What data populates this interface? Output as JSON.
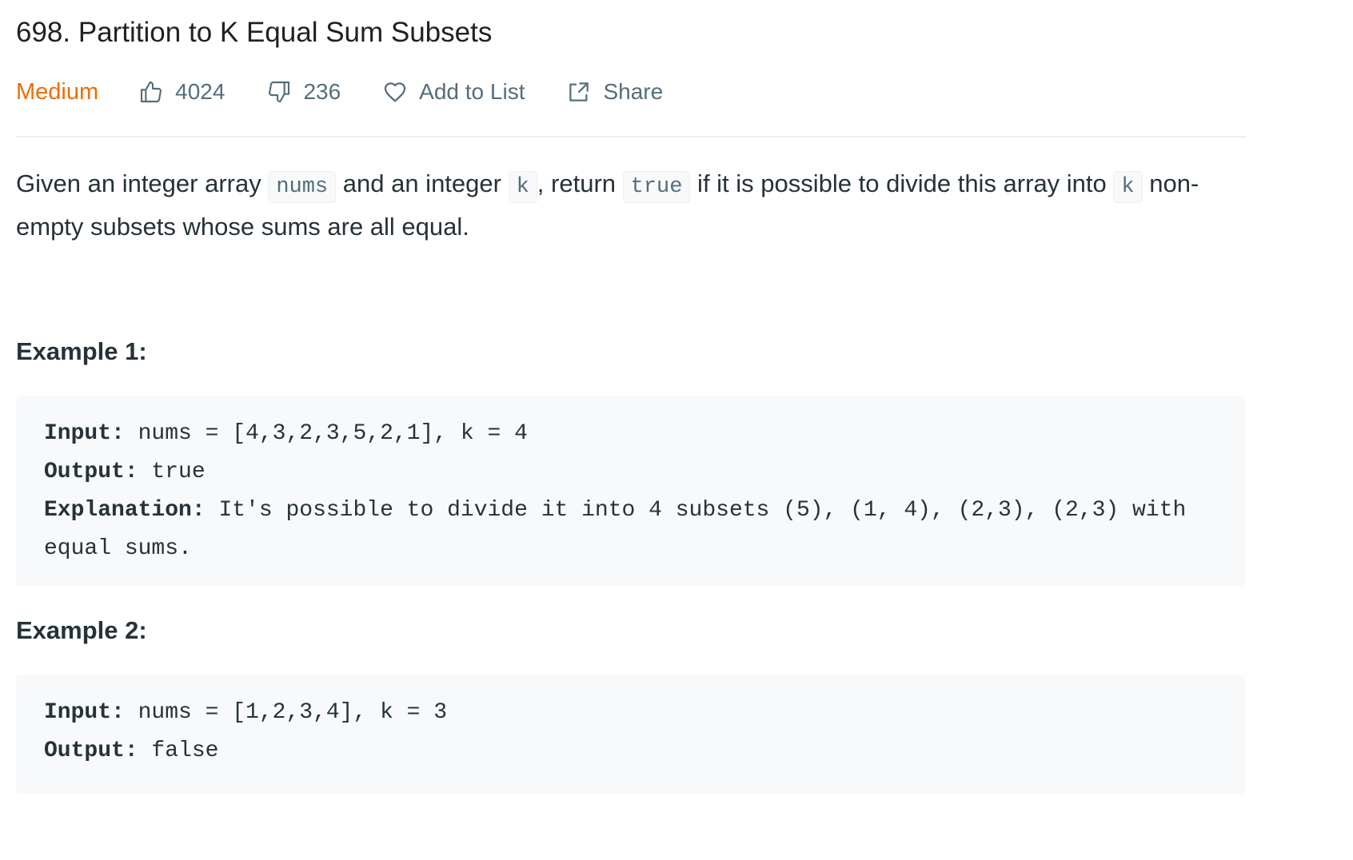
{
  "problem": {
    "title": "698. Partition to K Equal Sum Subsets",
    "difficulty": "Medium",
    "likes": "4024",
    "dislikes": "236",
    "add_to_list_label": "Add to List",
    "share_label": "Share"
  },
  "description": {
    "part1": "Given an integer array ",
    "code_nums": "nums",
    "part2": " and an integer ",
    "code_k1": "k",
    "part3": ", return ",
    "code_true": "true",
    "part4": " if it is possible to divide this array into ",
    "code_k2": "k",
    "part5": " non-empty subsets whose sums are all equal."
  },
  "examples": [
    {
      "heading": "Example 1:",
      "input_label": "Input:",
      "input_value": " nums = [4,3,2,3,5,2,1], k = 4",
      "output_label": "Output:",
      "output_value": " true",
      "explanation_label": "Explanation:",
      "explanation_value": " It's possible to divide it into 4 subsets (5), (1, 4), (2,3), (2,3) with equal sums."
    },
    {
      "heading": "Example 2:",
      "input_label": "Input:",
      "input_value": " nums = [1,2,3,4], k = 3",
      "output_label": "Output:",
      "output_value": " false"
    }
  ],
  "icons": {
    "like": "thumbs-up-icon",
    "dislike": "thumbs-down-icon",
    "add_to_list": "heart-icon",
    "share": "share-icon"
  },
  "colors": {
    "difficulty_medium": "#ef6c00",
    "meta_text": "#546e7a",
    "code_background": "#f7f9fa"
  }
}
